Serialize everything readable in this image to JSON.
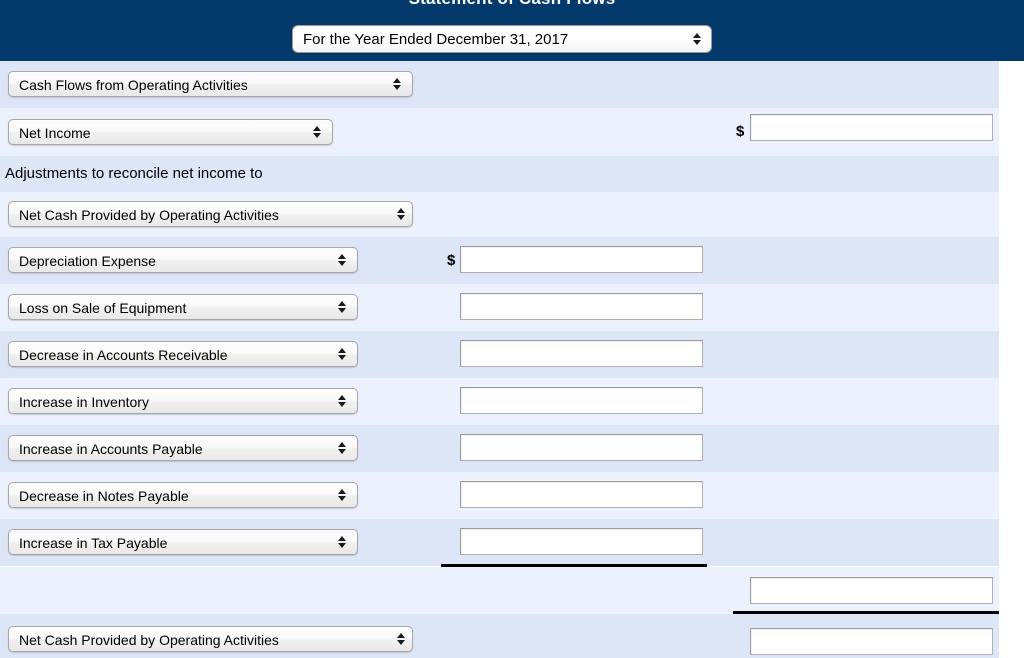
{
  "header": {
    "title": "Statement of Cash Flows",
    "period_select": "For the Year Ended December 31, 2017"
  },
  "statement": {
    "section_select": "Cash Flows from Operating Activities",
    "net_income_select": "Net Income",
    "net_income_dollar": "$",
    "net_income_value": "",
    "adjustments_note": "Adjustments to reconcile net income to",
    "adjustments_target_select": "Net Cash Provided by Operating Activities",
    "first_adjustment_dollar": "$",
    "adjustments": [
      {
        "label": "Depreciation Expense",
        "value": ""
      },
      {
        "label": "Loss on Sale of Equipment",
        "value": ""
      },
      {
        "label": "Decrease in Accounts Receivable",
        "value": ""
      },
      {
        "label": "Increase in Inventory",
        "value": ""
      },
      {
        "label": "Increase in Accounts Payable",
        "value": ""
      },
      {
        "label": "Decrease in Notes Payable",
        "value": ""
      },
      {
        "label": "Increase in Tax Payable",
        "value": ""
      }
    ],
    "adjustments_subtotal_value": "",
    "net_cash_select": "Net Cash Provided by Operating Activities",
    "net_cash_value": ""
  },
  "colors": {
    "header_bg": "#033a6b",
    "row_shade_a": "#dde6f7",
    "row_shade_b": "#ecf2fd",
    "rule": "#000000"
  }
}
